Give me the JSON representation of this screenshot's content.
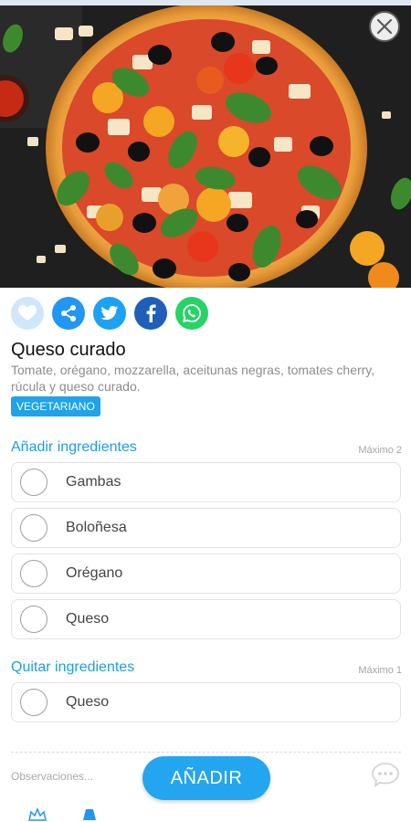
{
  "close_icon": "close-icon",
  "share": {
    "icons": [
      "heart-icon",
      "share-icon",
      "twitter-icon",
      "facebook-icon",
      "whatsapp-icon"
    ]
  },
  "product": {
    "name": "Queso curado",
    "description": "Tomate, orégano, mozzarella, aceitunas negras, tomates cherry, rúcula y queso curado.",
    "badge": "VEGETARIANO"
  },
  "add_section": {
    "title": "Añadir ingredientes",
    "max": "Máximo 2",
    "options": [
      "Gambas",
      "Boloñesa",
      "Orégano",
      "Queso"
    ]
  },
  "remove_section": {
    "title": "Quitar ingredientes",
    "max": "Máximo 1",
    "options": [
      "Queso"
    ]
  },
  "observations": {
    "placeholder": "Observaciones..."
  },
  "add_button": "AÑADIR",
  "colors": {
    "accent": "#1f9de0",
    "button": "#23a6ef",
    "badge": "#1fa3ea",
    "twitter": "#1da1f2",
    "facebook": "#1f5fb8",
    "whatsapp": "#25d366"
  }
}
